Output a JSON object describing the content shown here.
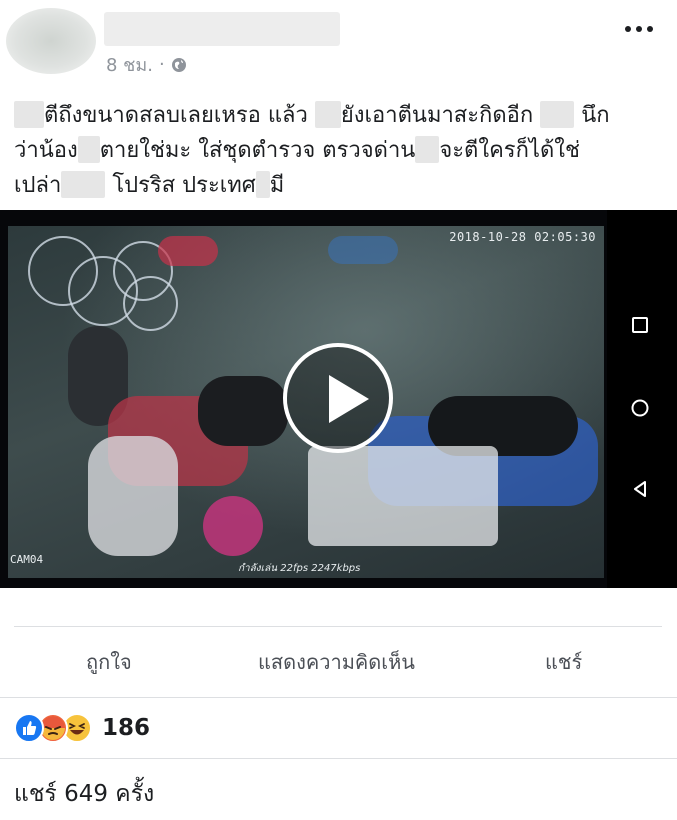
{
  "post": {
    "time": "8 ชม.",
    "separator": "·",
    "privacy_icon": "globe-icon",
    "more_icon": "more-options-icon",
    "text_segments": [
      "ตีถึงขนาดสลบเลยเหรอ แล้ว",
      "ยังเอาตีนมาสะกิดอีก",
      "นึก",
      "ว่าน้อง",
      "ตายใช่มะ ใส่ชุดตำรวจ ตรวจด่าน",
      "จะตีใครก็ได้ใช่",
      "เปล่า",
      "โปรริส ประเทศ",
      "มี"
    ]
  },
  "video": {
    "timestamp": "2018-10-28 02:05:30",
    "camera_label": "CAM04",
    "stream_info": "กำลังเล่น 22fps 2247kbps",
    "play_icon": "play-icon",
    "nav_icons": [
      "square-recent-icon",
      "circle-home-icon",
      "triangle-back-icon"
    ]
  },
  "actions": {
    "like": "ถูกใจ",
    "comment": "แสดงความคิดเห็น",
    "share": "แชร์"
  },
  "reactions": {
    "icons": [
      "like-reaction-icon",
      "angry-reaction-icon",
      "haha-reaction-icon"
    ],
    "count": "186",
    "colors": {
      "like": "#1877f2",
      "angry": "#f0623e",
      "haha": "#f7c33c"
    }
  },
  "shares": {
    "label": "แชร์ 649 ครั้ง"
  }
}
